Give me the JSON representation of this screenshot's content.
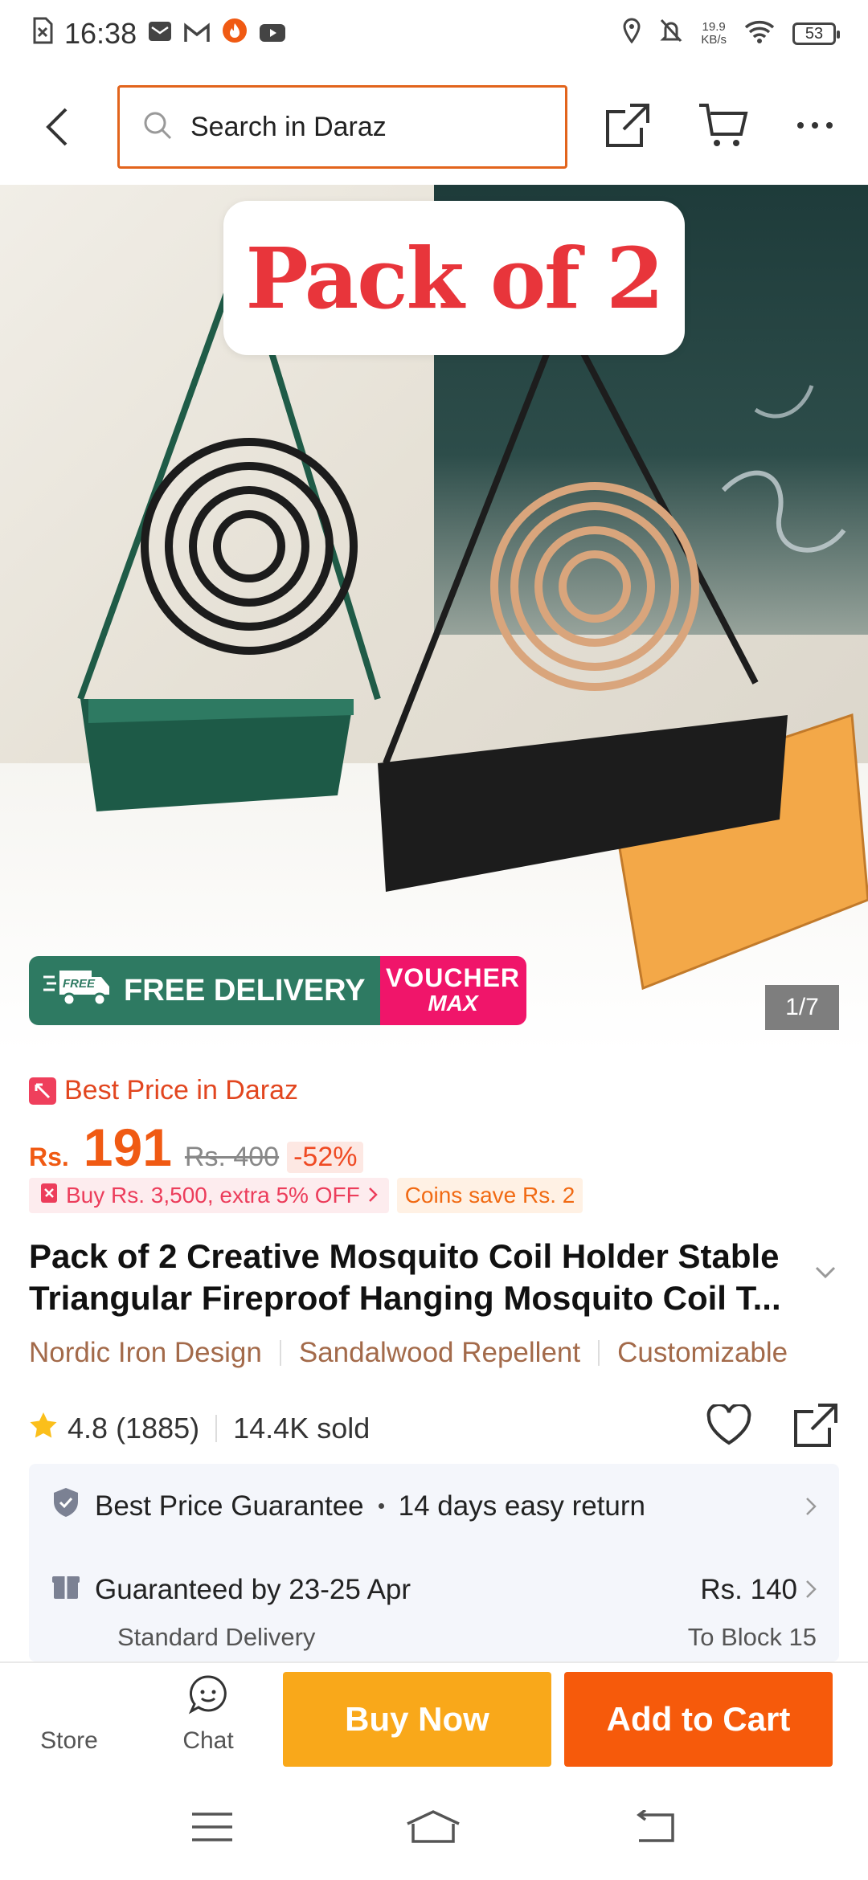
{
  "status_bar": {
    "time": "16:38",
    "net_speed": "19.9",
    "net_unit": "KB/s",
    "battery": "53"
  },
  "header": {
    "search_placeholder": "Search in Daraz"
  },
  "hero": {
    "overlay_text": "Pack of 2",
    "promo_free_label": "FREE DELIVERY",
    "promo_free_truck_text": "FREE",
    "voucher_line1": "VOUCHER",
    "voucher_line2": "MAX",
    "image_counter": "1/7"
  },
  "pricing": {
    "best_price_label": "Best Price in Daraz",
    "currency": "Rs.",
    "price": "191",
    "original_price": "Rs. 400",
    "discount": "-52%",
    "offer_text": "Buy Rs. 3,500, extra 5% OFF",
    "coins_text": "Coins save Rs. 2"
  },
  "product": {
    "title": "Pack of 2 Creative Mosquito Coil Holder Stable Triangular Fireproof Hanging Mosquito Coil T...",
    "tags": [
      "Nordic Iron Design",
      "Sandalwood Repellent",
      "Customizable"
    ],
    "rating": "4.8",
    "review_count": "(1885)",
    "sold": "14.4K sold"
  },
  "service": {
    "guarantee": "Best Price Guarantee",
    "returns": "14 days easy return",
    "delivery_date": "Guaranteed by 23-25 Apr",
    "delivery_type": "Standard Delivery",
    "delivery_price": "Rs. 140",
    "delivery_location": "To Block 15"
  },
  "bottom_bar": {
    "store_label": "Store",
    "chat_label": "Chat",
    "buy_now": "Buy Now",
    "add_to_cart": "Add to Cart"
  },
  "colors": {
    "accent": "#f65a0b",
    "buy_now": "#f9a81a",
    "price": "#f05a13",
    "search_border": "#e2641c"
  }
}
